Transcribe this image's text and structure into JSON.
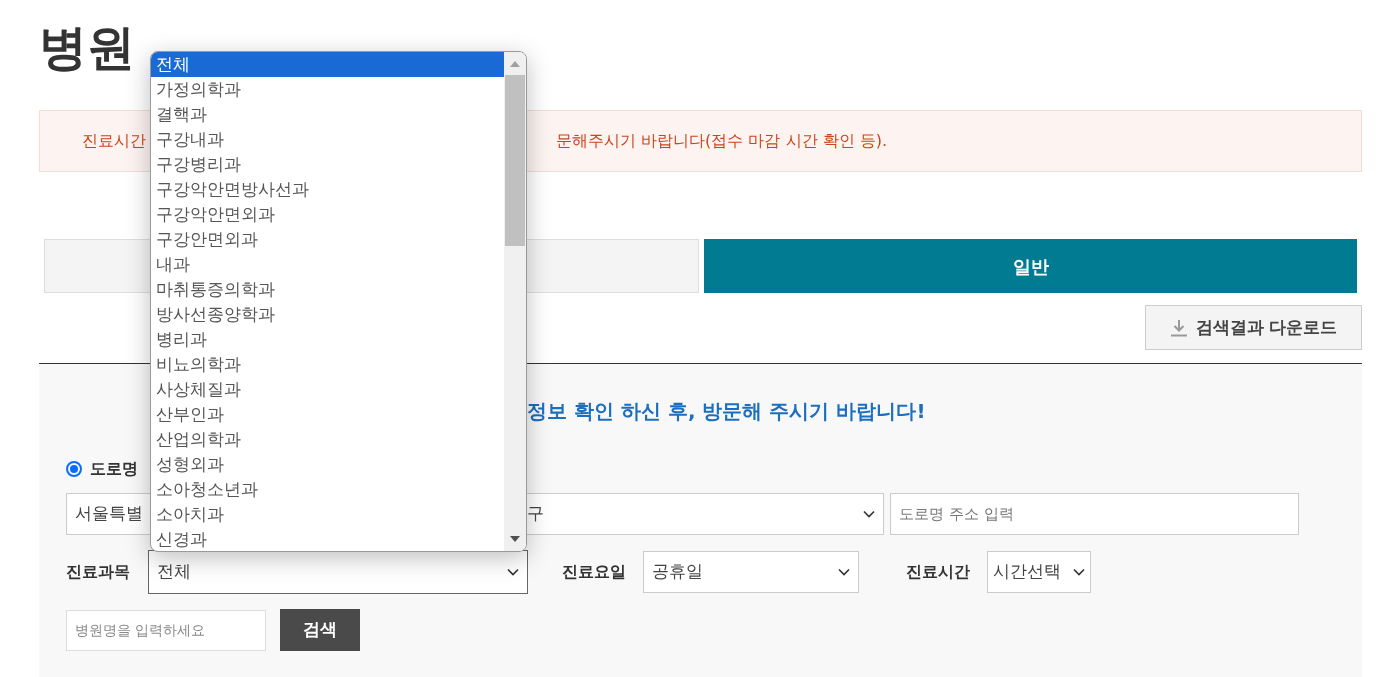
{
  "title": "병원",
  "notice": {
    "left": "진료시간",
    "right": "문해주시기 바랍니다(접수 마감 시간 확인 등)."
  },
  "tabs": [
    {
      "selected": false
    },
    {
      "label": "일반",
      "selected": true
    }
  ],
  "download_button": "검색결과 다운로드",
  "search_panel": {
    "heading": "정보 확인 하신 후, 방문해 주시기 바랍니다!",
    "address_type": {
      "label": "도로명",
      "selected": true
    },
    "city_select": "서울특별",
    "district_select": "구",
    "road_address_field": {
      "placeholder": "도로명 주소 입력"
    },
    "department": {
      "label": "진료과목",
      "value": "전체"
    },
    "day": {
      "label": "진료요일",
      "value": "공휴일"
    },
    "time": {
      "label": "진료시간",
      "value": "시간선택"
    },
    "hospital_name_field": {
      "placeholder": "병원명을 입력하세요"
    },
    "search_button": "검색"
  },
  "department_dropdown": [
    {
      "label": "전체",
      "selected": true
    },
    {
      "label": "가정의학과",
      "selected": false
    },
    {
      "label": "결핵과",
      "selected": false
    },
    {
      "label": "구강내과",
      "selected": false
    },
    {
      "label": "구강병리과",
      "selected": false
    },
    {
      "label": "구강악안면방사선과",
      "selected": false
    },
    {
      "label": "구강악안면외과",
      "selected": false
    },
    {
      "label": "구강안면외과",
      "selected": false
    },
    {
      "label": "내과",
      "selected": false
    },
    {
      "label": "마취통증의학과",
      "selected": false
    },
    {
      "label": "방사선종양학과",
      "selected": false
    },
    {
      "label": "병리과",
      "selected": false
    },
    {
      "label": "비뇨의학과",
      "selected": false
    },
    {
      "label": "사상체질과",
      "selected": false
    },
    {
      "label": "산부인과",
      "selected": false
    },
    {
      "label": "산업의학과",
      "selected": false
    },
    {
      "label": "성형외과",
      "selected": false
    },
    {
      "label": "소아청소년과",
      "selected": false
    },
    {
      "label": "소아치과",
      "selected": false
    },
    {
      "label": "신경과",
      "selected": false
    }
  ]
}
